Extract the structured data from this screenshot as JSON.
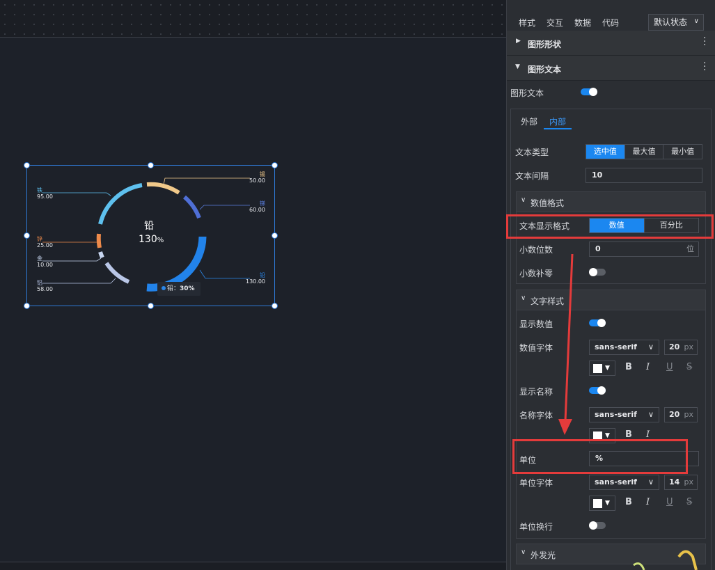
{
  "panel": {
    "tabs": [
      "样式",
      "交互",
      "数据",
      "代码"
    ],
    "state_select": "默认状态",
    "sections": {
      "shape": "图形形状",
      "text": "图形文本"
    },
    "graphic_text_label": "图形文本",
    "inner_tabs": [
      "外部",
      "内部"
    ],
    "text_type_label": "文本类型",
    "text_type_options": [
      "选中值",
      "最大值",
      "最小值"
    ],
    "text_gap_label": "文本间隔",
    "text_gap_value": "10",
    "number_format_header": "数值格式",
    "display_format_label": "文本显示格式",
    "display_format_options": [
      "数值",
      "百分比"
    ],
    "decimals_label": "小数位数",
    "decimals_value": "0",
    "decimals_unit": "位",
    "pad_zero_label": "小数补零",
    "text_style_header": "文字样式",
    "show_value_label": "显示数值",
    "value_font_label": "数值字体",
    "value_font": "sans-serif",
    "value_size": "20",
    "px_unit": "px",
    "show_name_label": "显示名称",
    "name_font_label": "名称字体",
    "name_font": "sans-serif",
    "name_size": "20",
    "unit_label": "单位",
    "unit_value": "%",
    "unit_font_label": "单位字体",
    "unit_font": "sans-serif",
    "unit_size": "14",
    "unit_wrap_label": "单位换行",
    "glow_header": "外发光",
    "format_buttons": [
      "B",
      "I",
      "U",
      "S"
    ]
  },
  "chart": {
    "center_name": "铅",
    "center_value": "130",
    "center_unit": "%",
    "tooltip_name": "铅：",
    "tooltip_value": "30%",
    "labels": [
      {
        "name": "铁",
        "value": "95.00",
        "color": "#5ec0ee"
      },
      {
        "name": "锡",
        "value": "50.00",
        "color": "#f1c98a"
      },
      {
        "name": "锑",
        "value": "60.00",
        "color": "#5a7fe0"
      },
      {
        "name": "锌",
        "value": "25.00",
        "color": "#ee8a4a"
      },
      {
        "name": "金",
        "value": "10.00",
        "color": "#c8d6f0"
      },
      {
        "name": "铝",
        "value": "58.00",
        "color": "#b6c4e6"
      },
      {
        "name": "铅",
        "value": "130.00",
        "color": "#2a86e8"
      }
    ]
  },
  "colors": {
    "accent": "#1b87f0",
    "highlight": "#e43b3b"
  }
}
